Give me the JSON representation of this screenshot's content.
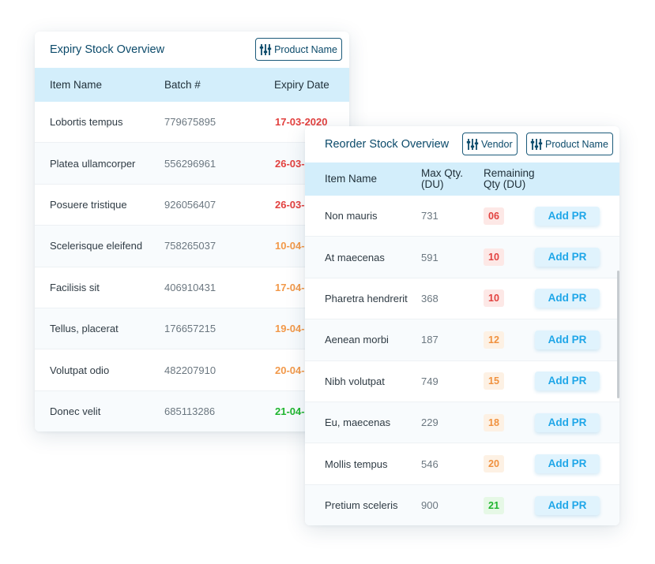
{
  "expiry": {
    "title": "Expiry Stock Overview",
    "filter_label": "Product Name",
    "columns": [
      "Item Name",
      "Batch #",
      "Expiry Date"
    ],
    "rows": [
      {
        "name": "Lobortis tempus",
        "batch": "779675895",
        "date": "17-03-2020",
        "status": "red"
      },
      {
        "name": "Platea ullamcorper",
        "batch": "556296961",
        "date": "26-03-",
        "status": "red"
      },
      {
        "name": "Posuere tristique",
        "batch": "926056407",
        "date": "26-03-",
        "status": "red"
      },
      {
        "name": "Scelerisque eleifend",
        "batch": "758265037",
        "date": "10-04-",
        "status": "orange"
      },
      {
        "name": "Facilisis sit",
        "batch": "406910431",
        "date": "17-04-",
        "status": "orange"
      },
      {
        "name": "Tellus, placerat",
        "batch": "176657215",
        "date": "19-04-",
        "status": "orange"
      },
      {
        "name": "Volutpat odio",
        "batch": "482207910",
        "date": "20-04-",
        "status": "orange"
      },
      {
        "name": "Donec velit",
        "batch": "685113286",
        "date": "21-04-",
        "status": "green"
      }
    ]
  },
  "reorder": {
    "title": "Reorder Stock Overview",
    "vendor_label": "Vendor",
    "filter_label": "Product Name",
    "columns": [
      "Item Name",
      "Max Qty.",
      "(DU)",
      "Remaining",
      "Qty (DU)"
    ],
    "action_label": "Add PR",
    "rows": [
      {
        "name": "Non mauris",
        "max": "731",
        "remaining": "06",
        "status": "red"
      },
      {
        "name": "At maecenas",
        "max": "591",
        "remaining": "10",
        "status": "red"
      },
      {
        "name": "Pharetra hendrerit",
        "max": "368",
        "remaining": "10",
        "status": "red"
      },
      {
        "name": "Aenean morbi",
        "max": "187",
        "remaining": "12",
        "status": "orange"
      },
      {
        "name": "Nibh volutpat",
        "max": "749",
        "remaining": "15",
        "status": "orange"
      },
      {
        "name": "Eu, maecenas",
        "max": "229",
        "remaining": "18",
        "status": "orange"
      },
      {
        "name": "Mollis tempus",
        "max": "546",
        "remaining": "20",
        "status": "orange"
      },
      {
        "name": "Pretium sceleris",
        "max": "900",
        "remaining": "21",
        "status": "green"
      }
    ]
  },
  "icons": {
    "filter": "sliders-icon"
  },
  "colors": {
    "brand": "#0b4a6a",
    "header_bg": "#d3eefb",
    "red": "#e2413f",
    "orange": "#f2994a",
    "green": "#1fb52e",
    "action": "#1ea6e8"
  }
}
